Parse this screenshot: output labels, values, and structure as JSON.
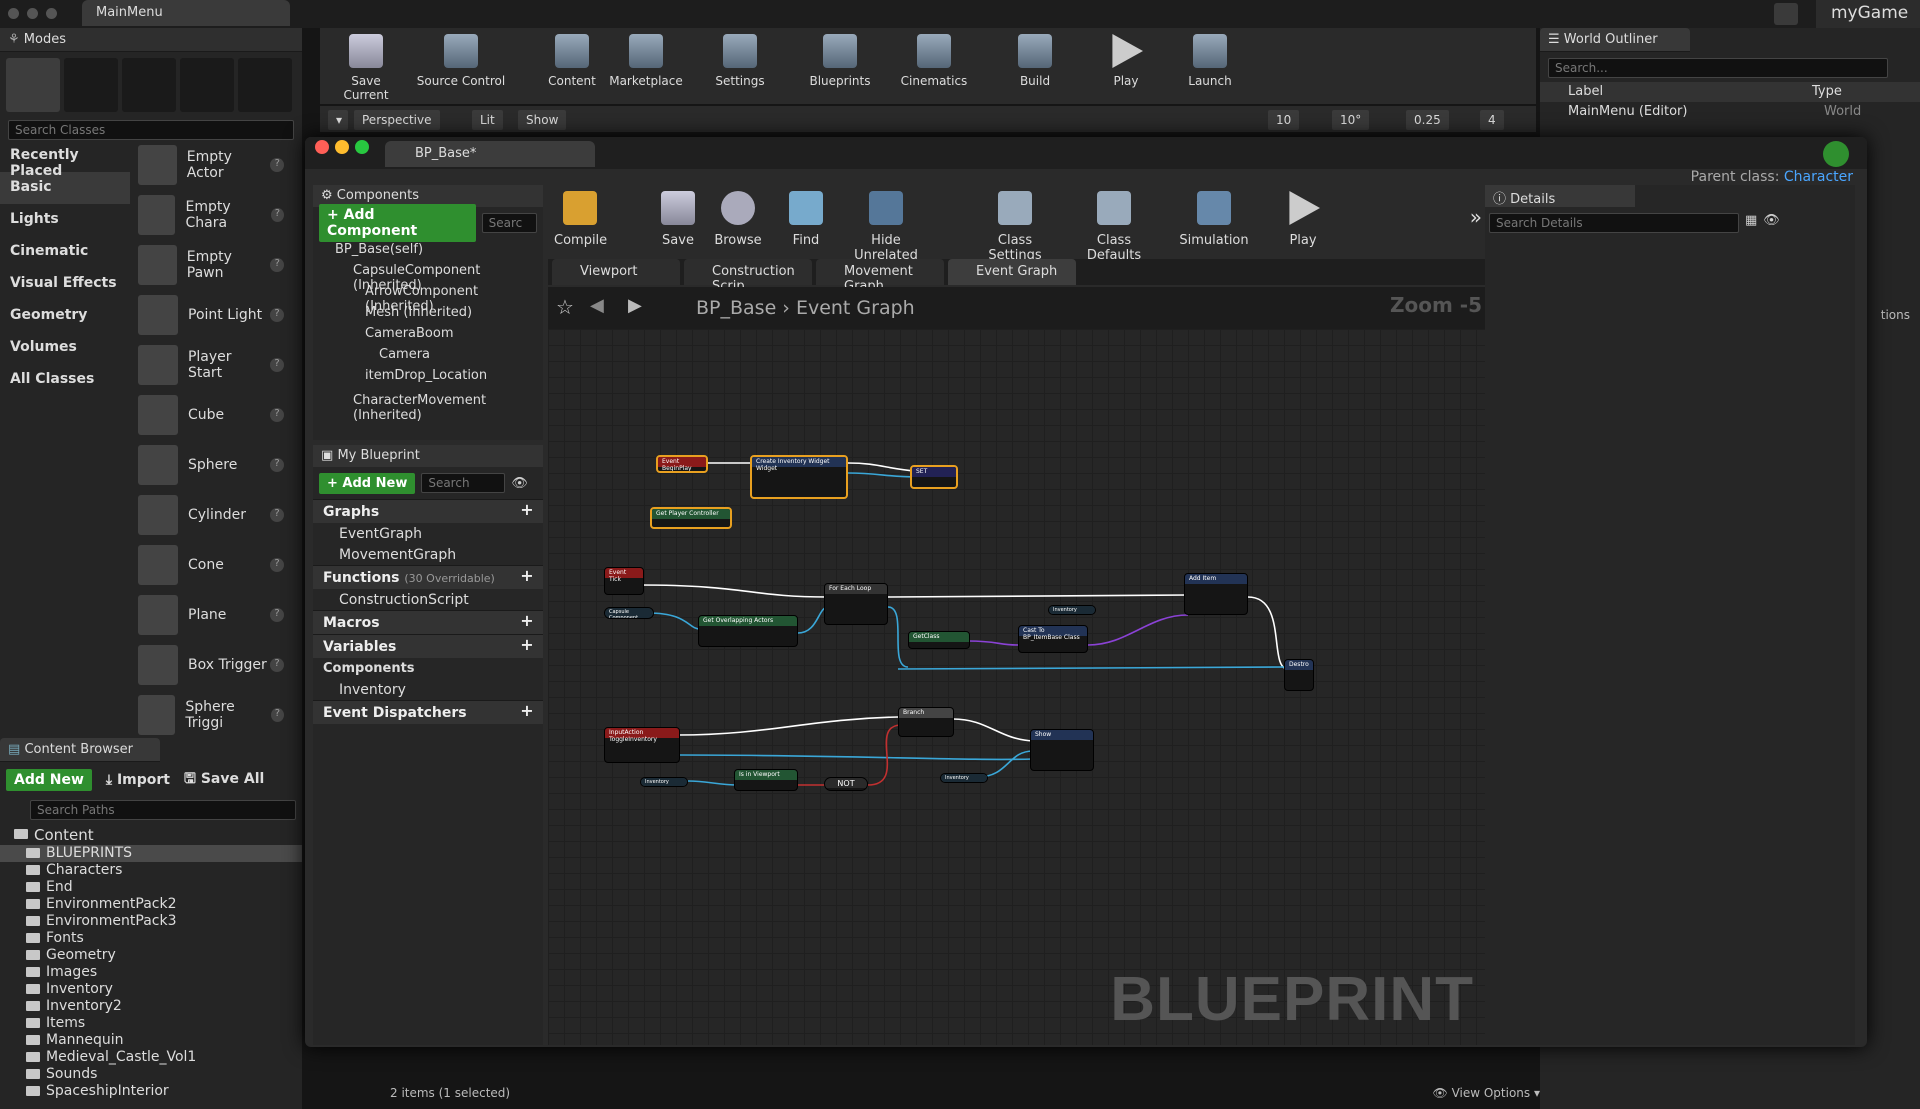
{
  "main": {
    "tab": "MainMenu",
    "game": "myGame"
  },
  "modes": {
    "title": "Modes",
    "search_placeholder": "Search Classes",
    "categories": [
      "Recently Placed",
      "Basic",
      "Lights",
      "Cinematic",
      "Visual Effects",
      "Geometry",
      "Volumes",
      "All Classes"
    ],
    "items": [
      "Empty Actor",
      "Empty Chara",
      "Empty Pawn",
      "Point Light",
      "Player Start",
      "Cube",
      "Sphere",
      "Cylinder",
      "Cone",
      "Plane",
      "Box Trigger",
      "Sphere Triggi"
    ]
  },
  "toolbar": {
    "buttons": [
      "Save Current",
      "Source Control",
      "Content",
      "Marketplace",
      "Settings",
      "Blueprints",
      "Cinematics",
      "Build",
      "Play",
      "Launch"
    ],
    "viewport": {
      "perspective": "Perspective",
      "lit": "Lit",
      "show": "Show",
      "grid": "10",
      "angle": "10°",
      "scale": "0.25",
      "cam": "4"
    }
  },
  "outliner": {
    "title": "World Outliner",
    "search_placeholder": "Search...",
    "col_label": "Label",
    "col_type": "Type",
    "row_label": "MainMenu (Editor)",
    "row_type": "World",
    "view_options": "tions"
  },
  "content_browser": {
    "title": "Content Browser",
    "add_new": "Add New",
    "import": "Import",
    "save_all": "Save All",
    "search_placeholder": "Search Paths",
    "root": "Content",
    "folders": [
      "BLUEPRINTS",
      "Characters",
      "End",
      "EnvironmentPack2",
      "EnvironmentPack3",
      "Fonts",
      "Geometry",
      "Images",
      "Inventory",
      "Inventory2",
      "Items",
      "Mannequin",
      "Medieval_Castle_Vol1",
      "Sounds",
      "SpaceshipInterior"
    ],
    "status": "2 items (1 selected)",
    "view_options": "View Options"
  },
  "bp": {
    "tab": "BP_Base*",
    "parent_label": "Parent class:",
    "parent_value": "Character",
    "components_title": "Components",
    "add_component": "+ Add Component",
    "comp_search": "Searc",
    "components": [
      "BP_Base(self)",
      "CapsuleComponent (Inherited)",
      "ArrowComponent (Inherited)",
      "Mesh (Inherited)",
      "CameraBoom",
      "Camera",
      "itemDrop_Location",
      "CharacterMovement (Inherited)"
    ],
    "mybp_title": "My Blueprint",
    "add_new": "+ Add New",
    "mybp_search": "Search",
    "graphs": "Graphs",
    "graph_items": [
      "EventGraph",
      "MovementGraph"
    ],
    "functions": "Functions",
    "functions_sub": "(30 Overridable)",
    "function_items": [
      "ConstructionScript"
    ],
    "macros": "Macros",
    "variables": "Variables",
    "var_group": "Components",
    "var_items": [
      "Inventory"
    ],
    "dispatchers": "Event Dispatchers",
    "tools": [
      "Compile",
      "Save",
      "Browse",
      "Find",
      "Hide Unrelated",
      "Class Settings",
      "Class Defaults",
      "Simulation",
      "Play"
    ],
    "graph_tabs": [
      "Viewport",
      "Construction Scrip",
      "Movement Graph",
      "Event Graph"
    ],
    "crumb_root": "BP_Base",
    "crumb_leaf": "Event Graph",
    "zoom": "Zoom -5",
    "watermark": "BLUEPRINT",
    "details_title": "Details",
    "details_search": "Search Details"
  },
  "nodes": {
    "begin_play": "Event BeginPlay",
    "create_widget": "Create Inventory Widget Widget",
    "set": "SET",
    "get_pc": "Get Player Controller",
    "tick": "Event Tick",
    "capsule": "Capsule Component",
    "overlap": "Get Overlapping Actors",
    "foreach": "For Each Loop",
    "getclass": "GetClass",
    "cast": "Cast To BP_ItemBase Class",
    "inventory": "Inventory",
    "add_item": "Add Item",
    "destroy": "Destro",
    "input": "InputAction ToggleInventory",
    "branch": "Branch",
    "show": "Show",
    "inviewport": "Is in Viewport",
    "not": "NOT"
  }
}
